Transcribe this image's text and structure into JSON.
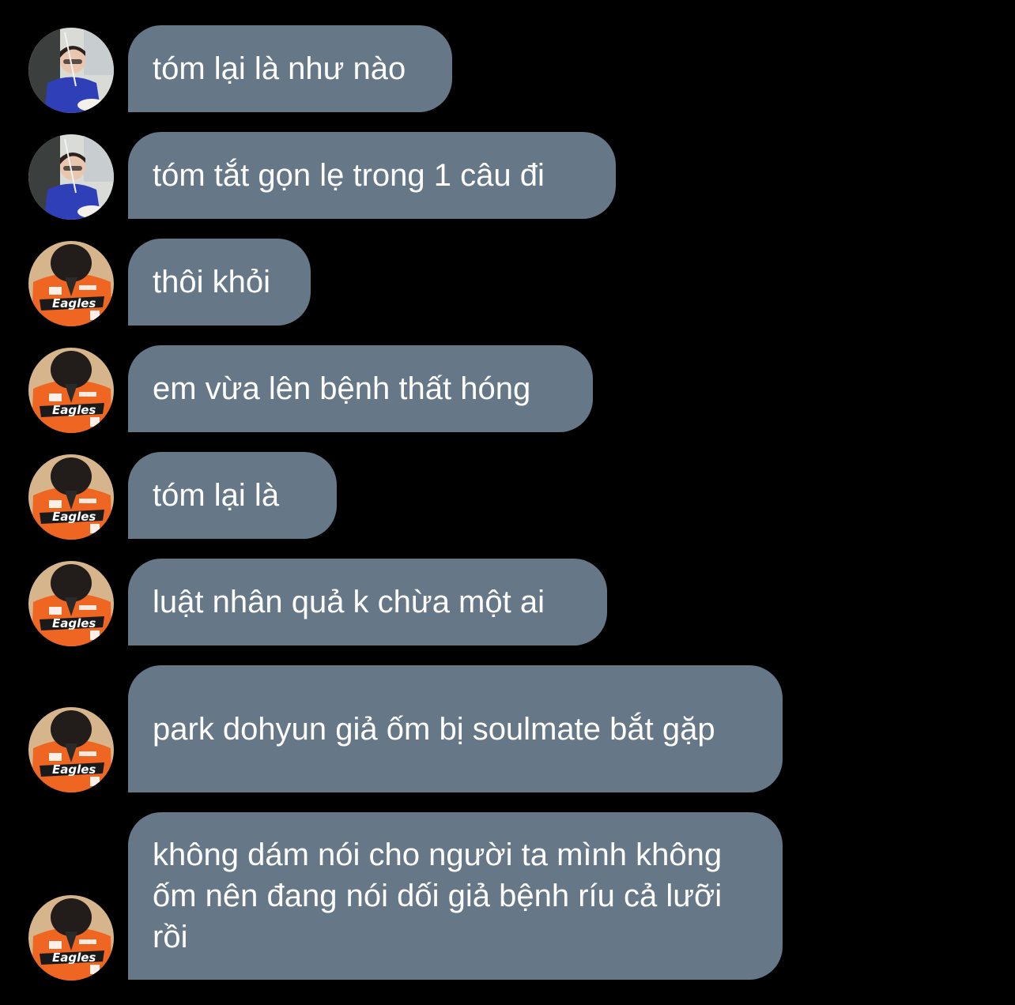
{
  "colors": {
    "background": "#000000",
    "bubble": "#667788",
    "text": "#ffffff",
    "jersey": "#ee6622"
  },
  "avatars": {
    "blue_shirt": "avatar-blue-shirt-person",
    "orange_jersey": "avatar-orange-eagles-jersey",
    "jersey_text": "Eagles"
  },
  "messages": [
    {
      "text": "tóm lại là như nào",
      "avatar": "blue_shirt"
    },
    {
      "text": "tóm tắt gọn lẹ trong 1 câu đi",
      "avatar": "blue_shirt"
    },
    {
      "text": "thôi khỏi",
      "avatar": "orange_jersey"
    },
    {
      "text": "em vừa lên bệnh thất hóng",
      "avatar": "orange_jersey"
    },
    {
      "text": "tóm lại là",
      "avatar": "orange_jersey"
    },
    {
      "text": "luật nhân quả k chừa một ai",
      "avatar": "orange_jersey"
    },
    {
      "text": "park dohyun giả ốm bị soulmate bắt gặp",
      "avatar": "orange_jersey"
    },
    {
      "text": "không dám nói cho người ta mình không ốm nên đang nói dối giả bệnh ríu cả lưỡi rồi",
      "avatar": "orange_jersey"
    }
  ]
}
